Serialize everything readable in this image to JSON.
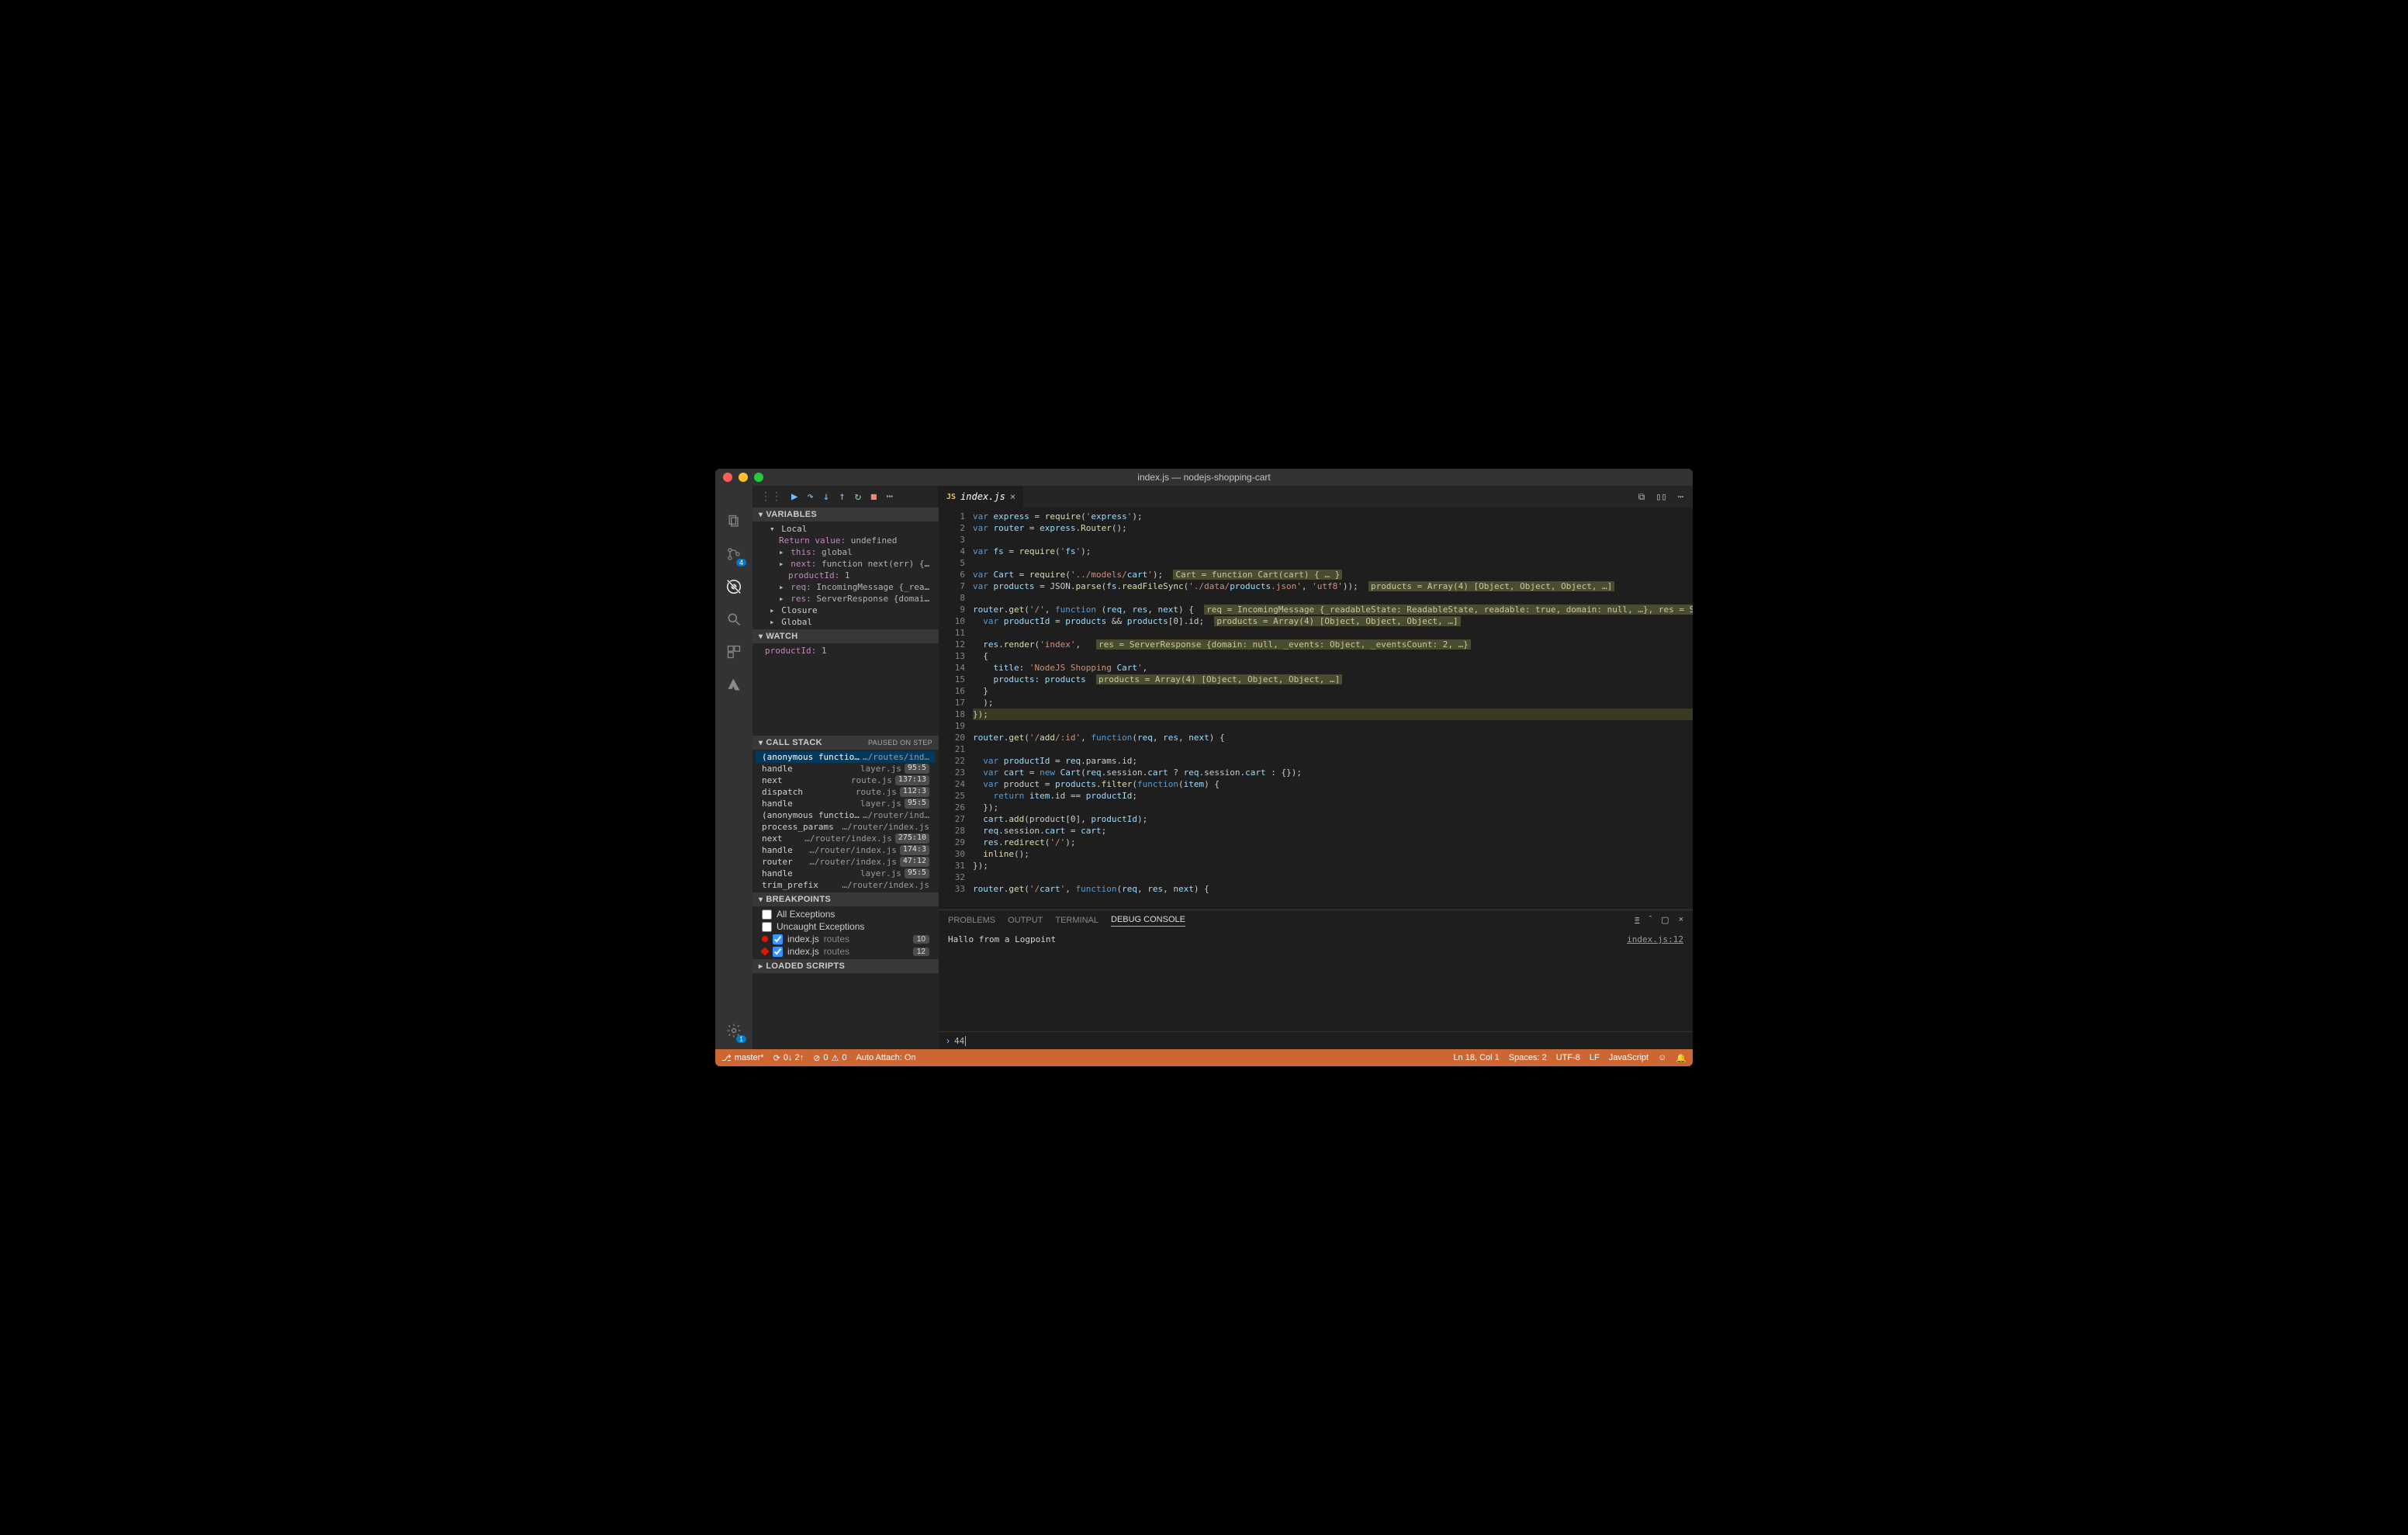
{
  "window": {
    "title": "index.js — nodejs-shopping-cart"
  },
  "tab": {
    "filename": "index.js"
  },
  "activity": {
    "debug_badge": "4",
    "settings_badge": "1"
  },
  "sidebar": {
    "variables_title": "VARIABLES",
    "local_title": "Local",
    "return_label": "Return value:",
    "return_value": "undefined",
    "this_label": "this:",
    "this_value": "global",
    "next_label": "next:",
    "next_value": "function next(err) { … }",
    "productId_label": "productId:",
    "productId_value": "1",
    "req_label": "req:",
    "req_value": "IncomingMessage {_readableSt…",
    "res_label": "res:",
    "res_value": "ServerResponse {domain: null…",
    "closure_title": "Closure",
    "global_title": "Global",
    "watch_title": "WATCH",
    "watch_item_label": "productId:",
    "watch_item_value": "1",
    "callstack_title": "CALL STACK",
    "callstack_rhs": "PAUSED ON STEP",
    "callstack": [
      {
        "fn": "(anonymous function)",
        "file": "…/routes/ind…",
        "lc": ""
      },
      {
        "fn": "handle",
        "file": "layer.js",
        "lc": "95:5"
      },
      {
        "fn": "next",
        "file": "route.js",
        "lc": "137:13"
      },
      {
        "fn": "dispatch",
        "file": "route.js",
        "lc": "112:3"
      },
      {
        "fn": "handle",
        "file": "layer.js",
        "lc": "95:5"
      },
      {
        "fn": "(anonymous function)",
        "file": "…/router/ind…",
        "lc": ""
      },
      {
        "fn": "process_params",
        "file": "…/router/index.js",
        "lc": ""
      },
      {
        "fn": "next",
        "file": "…/router/index.js",
        "lc": "275:10"
      },
      {
        "fn": "handle",
        "file": "…/router/index.js",
        "lc": "174:3"
      },
      {
        "fn": "router",
        "file": "…/router/index.js",
        "lc": "47:12"
      },
      {
        "fn": "handle",
        "file": "layer.js",
        "lc": "95:5"
      },
      {
        "fn": "trim_prefix",
        "file": "…/router/index.js",
        "lc": ""
      }
    ],
    "breakpoints_title": "BREAKPOINTS",
    "bp_all": "All Exceptions",
    "bp_uncaught": "Uncaught Exceptions",
    "bp_items": [
      {
        "file": "index.js",
        "folder": "routes",
        "line": "10"
      },
      {
        "file": "index.js",
        "folder": "routes",
        "line": "12"
      }
    ],
    "loaded_title": "LOADED SCRIPTS"
  },
  "code": {
    "lines": [
      "var express = require('express');",
      "var router = express.Router();",
      "",
      "var fs = require('fs');",
      "",
      "var Cart = require('../models/cart');  Cart = function Cart(cart) { … }",
      "var products = JSON.parse(fs.readFileSync('./data/products.json', 'utf8'));  products = Array(4) [Object, Object, Object, …]",
      "",
      "router.get('/', function (req, res, next) {  req = IncomingMessage {_readableState: ReadableState, readable: true, domain: null, …}, res = ServerRes",
      "  var productId = products && products[0].id;  products = Array(4) [Object, Object, Object, …]",
      "",
      "  res.render('index',   res = ServerResponse {domain: null, _events: Object, _eventsCount: 2, …}",
      "  {",
      "    title: 'NodeJS Shopping Cart',",
      "    products: products  products = Array(4) [Object, Object, Object, …]",
      "  }",
      "  );",
      "});",
      "",
      "router.get('/add/:id', function(req, res, next) {",
      "",
      "  var productId = req.params.id;",
      "  var cart = new Cart(req.session.cart ? req.session.cart : {});",
      "  var product = products.filter(function(item) {",
      "    return item.id == productId;",
      "  });",
      "  cart.add(product[0], productId);",
      "  req.session.cart = cart;",
      "  res.redirect('/');",
      "  inline();",
      "});",
      "",
      "router.get('/cart', function(req, res, next) {"
    ],
    "hint_lines": [
      6,
      7,
      9,
      10,
      12,
      15
    ],
    "current_line": 18,
    "bp": {
      "10": "dot",
      "12": "diamond"
    }
  },
  "panel": {
    "tabs": {
      "problems": "PROBLEMS",
      "output": "OUTPUT",
      "terminal": "TERMINAL",
      "debug": "DEBUG CONSOLE"
    },
    "message": "Hallo from a Logpoint",
    "source": "index.js:12",
    "repl_value": "44"
  },
  "status": {
    "branch": "master*",
    "sync": "0↓ 2↑",
    "errors": "0",
    "warnings": "0",
    "auto_attach": "Auto Attach: On",
    "position": "Ln 18, Col 1",
    "spaces": "Spaces: 2",
    "encoding": "UTF-8",
    "eol": "LF",
    "lang": "JavaScript"
  }
}
